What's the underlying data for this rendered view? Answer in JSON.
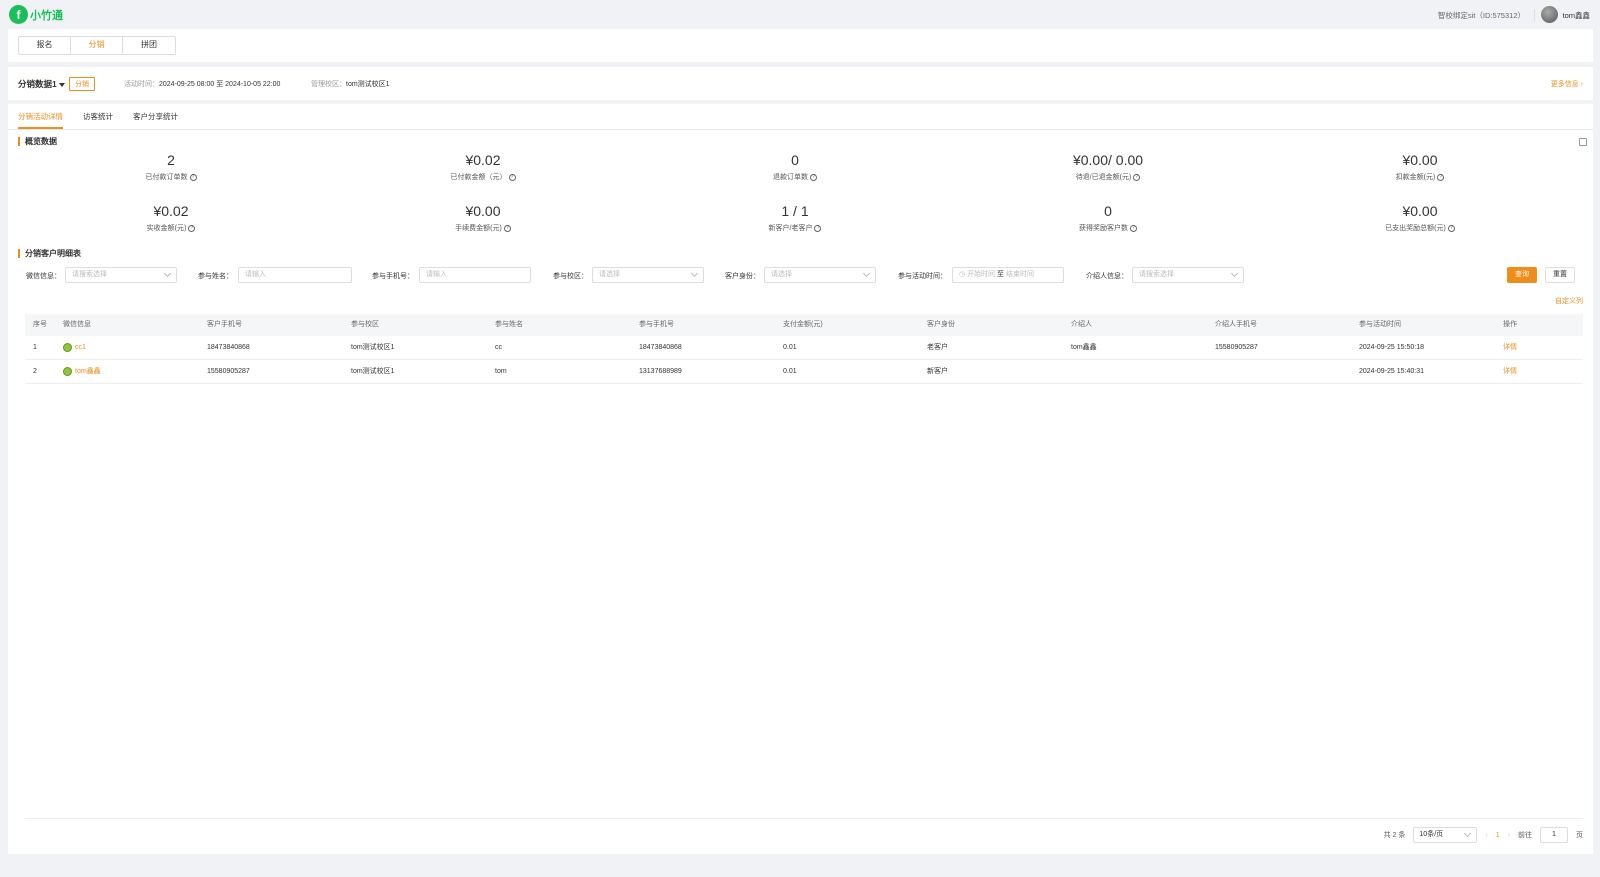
{
  "header": {
    "logo_mark": "f",
    "logo_text": "小竹通",
    "school": "智校绑定sit（ID:575312）",
    "username": "tom鑫鑫"
  },
  "modes": [
    {
      "label": "报名",
      "active": false
    },
    {
      "label": "分销",
      "active": true
    },
    {
      "label": "拼团",
      "active": false
    }
  ],
  "activity": {
    "name": "分销数据1",
    "tag": "分销",
    "time_label": "活动时间：",
    "time_value": "2024-09-25 08:00 至 2024-10-05 22:00",
    "campus_label": "管理校区：",
    "campus_value": "tom测试校区1",
    "more": "更多信息"
  },
  "subtabs": [
    {
      "label": "分销活动详情",
      "active": true
    },
    {
      "label": "访客统计",
      "active": false
    },
    {
      "label": "客户分享统计",
      "active": false
    }
  ],
  "overview": {
    "title": "概览数据",
    "stats": [
      {
        "value": "2",
        "label": "已付款订单数"
      },
      {
        "value": "¥0.02",
        "label": "已付款金额（元）"
      },
      {
        "value": "0",
        "label": "退款订单数"
      },
      {
        "value": "¥0.00/ 0.00",
        "label": "待退/已退金额(元)"
      },
      {
        "value": "¥0.00",
        "label": "扣款金额(元)"
      },
      {
        "value": "¥0.02",
        "label": "实收金额(元)"
      },
      {
        "value": "¥0.00",
        "label": "手续费金额(元)"
      },
      {
        "value": "1 / 1",
        "label": "新客户/老客户"
      },
      {
        "value": "0",
        "label": "获得奖励客户数"
      },
      {
        "value": "¥0.00",
        "label": "已支出奖励总额(元)"
      }
    ]
  },
  "detail": {
    "title": "分销客户明细表",
    "filters": {
      "wechat_label": "微信信息：",
      "wechat_ph": "请搜索选择",
      "name_label": "参与姓名：",
      "name_ph": "请输入",
      "phone_label": "参与手机号：",
      "phone_ph": "请输入",
      "campus_label": "参与校区：",
      "campus_ph": "请选择",
      "identity_label": "客户身份：",
      "identity_ph": "请选择",
      "time_label": "参与活动时间：",
      "time_start": "开始时间",
      "time_sep": "至",
      "time_end": "结束时间",
      "referrer_label": "介绍人信息：",
      "referrer_ph": "请搜索选择",
      "query": "查询",
      "reset": "重置",
      "custom_cols": "自定义列"
    },
    "columns": [
      "序号",
      "微信信息",
      "客户手机号",
      "参与校区",
      "参与姓名",
      "参与手机号",
      "支付金额(元)",
      "客户身份",
      "介绍人",
      "介绍人手机号",
      "参与活动时间",
      "操作"
    ],
    "rows": [
      {
        "no": "1",
        "wechat": "cc1",
        "phone": "18473840868",
        "campus": "tom测试校区1",
        "name": "cc",
        "join_phone": "18473840868",
        "amount": "0.01",
        "identity": "老客户",
        "referrer": "tom鑫鑫",
        "referrer_phone": "15580905287",
        "time": "2024-09-25 15:50:18",
        "action": "详情"
      },
      {
        "no": "2",
        "wechat": "tom鑫鑫",
        "phone": "15580905287",
        "campus": "tom测试校区1",
        "name": "tom",
        "join_phone": "13137688989",
        "amount": "0.01",
        "identity": "新客户",
        "referrer": "",
        "referrer_phone": "",
        "time": "2024-09-25 15:40:31",
        "action": "详情"
      }
    ]
  },
  "pager": {
    "total": "共 2 条",
    "page_size": "10条/页",
    "prev": "‹",
    "current": "1",
    "next": "›",
    "goto_label": "前往",
    "goto_value": "1",
    "page_suffix": "页"
  },
  "colors": {
    "accent": "#f08c1a",
    "brand": "#1bbf5a"
  }
}
